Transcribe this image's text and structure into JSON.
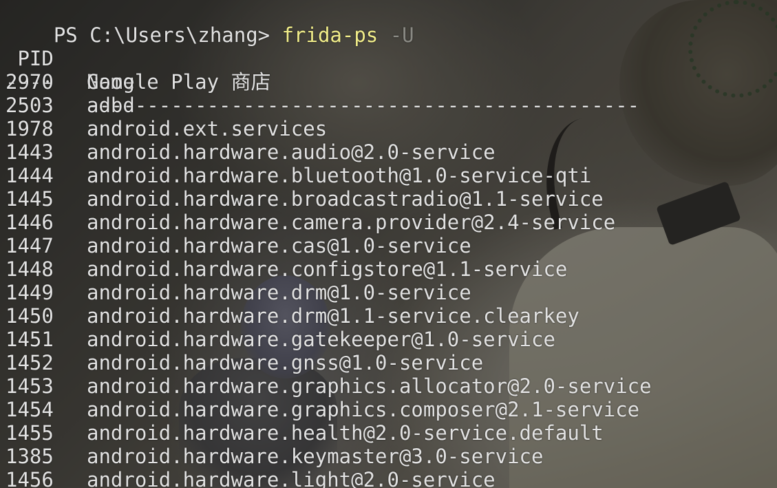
{
  "terminal": {
    "prompt": "PS C:\\Users\\zhang> ",
    "command": "frida-ps",
    "command_arg": " -U",
    "header": {
      "pid": " PID",
      "name": "Name"
    },
    "separator": {
      "pid": "----",
      "name": "----------------------------------------------"
    },
    "rows": [
      {
        "pid": "2970",
        "name": "Google Play 商店"
      },
      {
        "pid": "2503",
        "name": "adbd"
      },
      {
        "pid": "1978",
        "name": "android.ext.services"
      },
      {
        "pid": "1443",
        "name": "android.hardware.audio@2.0-service"
      },
      {
        "pid": "1444",
        "name": "android.hardware.bluetooth@1.0-service-qti"
      },
      {
        "pid": "1445",
        "name": "android.hardware.broadcastradio@1.1-service"
      },
      {
        "pid": "1446",
        "name": "android.hardware.camera.provider@2.4-service"
      },
      {
        "pid": "1447",
        "name": "android.hardware.cas@1.0-service"
      },
      {
        "pid": "1448",
        "name": "android.hardware.configstore@1.1-service"
      },
      {
        "pid": "1449",
        "name": "android.hardware.drm@1.0-service"
      },
      {
        "pid": "1450",
        "name": "android.hardware.drm@1.1-service.clearkey"
      },
      {
        "pid": "1451",
        "name": "android.hardware.gatekeeper@1.0-service"
      },
      {
        "pid": "1452",
        "name": "android.hardware.gnss@1.0-service"
      },
      {
        "pid": "1453",
        "name": "android.hardware.graphics.allocator@2.0-service"
      },
      {
        "pid": "1454",
        "name": "android.hardware.graphics.composer@2.1-service"
      },
      {
        "pid": "1455",
        "name": "android.hardware.health@2.0-service.default"
      },
      {
        "pid": "1385",
        "name": "android.hardware.keymaster@3.0-service"
      },
      {
        "pid": "1456",
        "name": "android.hardware.light@2.0-service"
      }
    ]
  },
  "colors": {
    "text": "#e2e2e2",
    "command": "#f2ee8a",
    "command_arg": "#8a8a84"
  }
}
